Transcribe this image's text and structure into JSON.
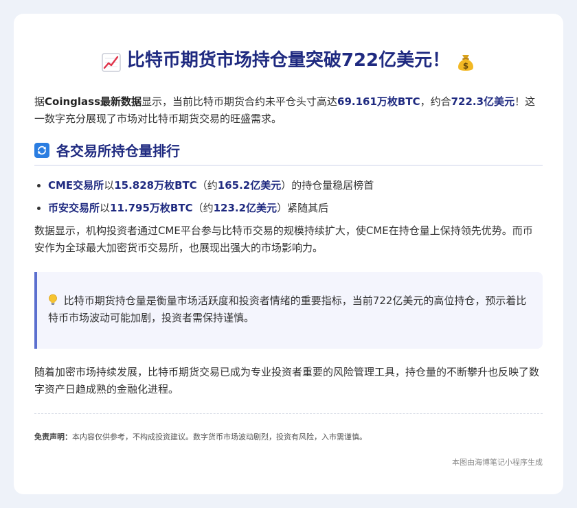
{
  "title": {
    "text": "比特币期货市场持仓量突破722亿美元！",
    "left_icon": "chart-increasing-icon",
    "right_icon": "money-bag-icon"
  },
  "intro": {
    "t1": "据",
    "source": "Coinglass",
    "t2": "最新数据",
    "t3": "显示，当前比特币期货合约未平仓头寸高达",
    "btc": "69.161万枚BTC",
    "t4": "，约合",
    "usd": "722.3亿美元",
    "t5": "！这一数字充分展现了市场对比特币期货交易的旺盛需求。"
  },
  "section": {
    "icon": "refresh-arrows-icon",
    "heading": "各交易所持仓量排行"
  },
  "rankings": [
    {
      "exchange": "CME交易所",
      "t1": "以",
      "btc": "15.828万枚BTC",
      "t2": "（约",
      "usd": "165.2亿美元",
      "t3": "）的持仓量稳居榜首"
    },
    {
      "exchange": "币安交易所",
      "t1": "以",
      "btc": "11.795万枚BTC",
      "t2": "（约",
      "usd": "123.2亿美元",
      "t3": "）紧随其后"
    }
  ],
  "analysis": "数据显示，机构投资者通过CME平台参与比特币交易的规模持续扩大，使CME在持仓量上保持领先优势。而币安作为全球最大加密货币交易所，也展现出强大的市场影响力。",
  "callout": {
    "icon": "light-bulb-icon",
    "text": "比特币期货持仓量是衡量市场活跃度和投资者情绪的重要指标，当前722亿美元的高位持仓，预示着比特币市场波动可能加剧，投资者需保持谨慎。"
  },
  "conclusion": "随着加密市场持续发展，比特币期货交易已成为专业投资者重要的风险管理工具，持仓量的不断攀升也反映了数字资产日趋成熟的金融化进程。",
  "disclaimer": {
    "label": "免责声明：",
    "text": "本内容仅供参考，不构成投资建议。数字货币市场波动剧烈，投资有风险，入市需谨慎。"
  },
  "footer": "本图由海博笔记小程序生成",
  "colors": {
    "accent": "#1f2a80",
    "callout_border": "#5b6fcf",
    "callout_bg": "#f4f5fd",
    "page_bg": "#eef2f9"
  }
}
